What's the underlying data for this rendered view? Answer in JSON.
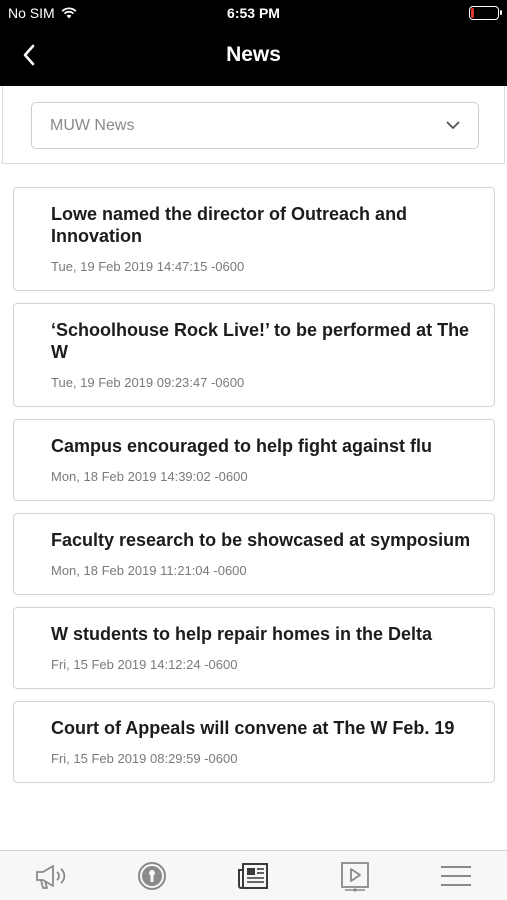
{
  "status_bar": {
    "carrier": "No SIM",
    "time": "6:53 PM",
    "battery_level": 0.1,
    "battery_color": "#e0352b"
  },
  "nav": {
    "title": "News",
    "back_icon": "chevron-left-icon"
  },
  "filter": {
    "selected": "MUW News",
    "icon": "chevron-down-icon"
  },
  "news": [
    {
      "headline": "Lowe named the director of Outreach and Innovation",
      "date": "Tue, 19 Feb 2019 14:47:15 -0600"
    },
    {
      "headline": "‘Schoolhouse Rock Live!’ to be performed at The W",
      "date": "Tue, 19 Feb 2019 09:23:47 -0600"
    },
    {
      "headline": "Campus encouraged to help fight against flu",
      "date": "Mon, 18 Feb 2019 14:39:02 -0600"
    },
    {
      "headline": "Faculty research to be showcased at symposium",
      "date": "Mon, 18 Feb 2019 11:21:04 -0600"
    },
    {
      "headline": "W students to help repair homes in the Delta",
      "date": "Fri, 15 Feb 2019 14:12:24 -0600"
    },
    {
      "headline": "Court of Appeals will convene at The W Feb. 19",
      "date": "Fri, 15 Feb 2019 08:29:59 -0600"
    }
  ],
  "tabs": [
    {
      "icon": "megaphone-icon"
    },
    {
      "icon": "keyhole-icon"
    },
    {
      "icon": "newspaper-icon",
      "active": true
    },
    {
      "icon": "video-play-icon"
    },
    {
      "icon": "menu-icon"
    }
  ],
  "colors": {
    "header_bg": "#000000",
    "tab_icon": "#8a8a8a",
    "tab_icon_active": "#3a3a3a"
  }
}
